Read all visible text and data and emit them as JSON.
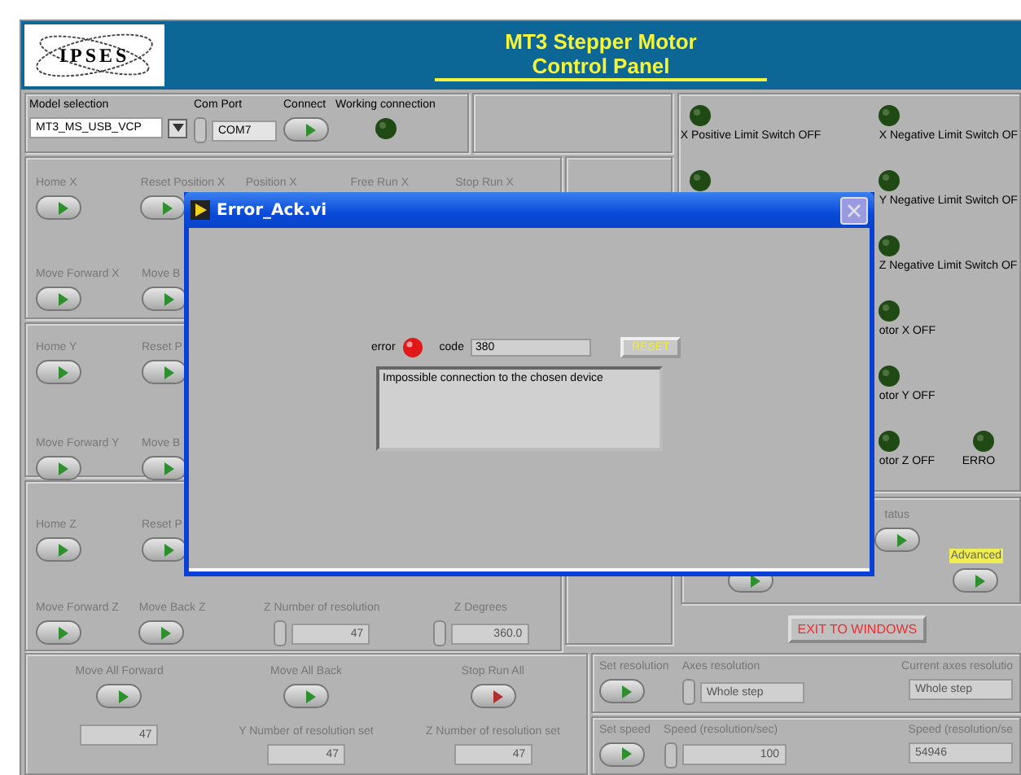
{
  "header": {
    "logo": "IPSES",
    "title": [
      "MT3 Stepper Motor",
      "Control Panel"
    ]
  },
  "connection": {
    "disabled": false,
    "controls": [
      {
        "kind": "ring",
        "label": "Model selection",
        "value": "MT3_MS_USB_VCP"
      },
      {
        "kind": "spin",
        "label": "Com Port",
        "value": "COM7"
      },
      {
        "kind": "switch",
        "label": "Connect",
        "color": "#2e8f2e"
      },
      {
        "kind": "led",
        "label": "Working connection",
        "on": false
      }
    ]
  },
  "axis_panels": [
    {
      "disabled": true,
      "rows": [
        [
          {
            "kind": "switch",
            "label": "Home X",
            "color": "#2e8f2e"
          },
          {
            "kind": "switch",
            "label": "Reset Position X",
            "color": "#2e8f2e"
          },
          {
            "kind": "label",
            "label": "Position X"
          },
          {
            "kind": "label",
            "label": "Free Run X"
          },
          {
            "kind": "label",
            "label": "Stop Run X"
          }
        ],
        [
          {
            "kind": "switch",
            "label": "Move Forward X",
            "color": "#2e8f2e"
          },
          {
            "kind": "switch",
            "label": "Move B",
            "color": "#2e8f2e"
          }
        ]
      ]
    },
    {
      "disabled": true,
      "rows": [
        [
          {
            "kind": "switch",
            "label": "Home Y",
            "color": "#2e8f2e"
          },
          {
            "kind": "switch",
            "label": "Reset P",
            "color": "#2e8f2e"
          }
        ],
        [
          {
            "kind": "switch",
            "label": "Move Forward Y",
            "color": "#2e8f2e"
          },
          {
            "kind": "switch",
            "label": "Move B",
            "color": "#2e8f2e"
          }
        ]
      ]
    },
    {
      "disabled": true,
      "rows": [
        [
          {
            "kind": "switch",
            "label": "Home Z",
            "color": "#2e8f2e"
          },
          {
            "kind": "switch",
            "label": "Reset P",
            "color": "#2e8f2e"
          }
        ],
        [
          {
            "kind": "switch",
            "label": "Move Forward Z",
            "color": "#2e8f2e"
          },
          {
            "kind": "switch",
            "label": "Move Back Z",
            "color": "#2e8f2e"
          },
          {
            "kind": "spin",
            "label": "Z Number of resolution",
            "value": "47"
          },
          {
            "kind": "spin",
            "label": "Z Degrees",
            "value": "360.0"
          }
        ]
      ]
    }
  ],
  "all_axes": {
    "disabled": true,
    "rows": [
      [
        {
          "kind": "switch",
          "label": "Move All Forward",
          "color": "#2e8f2e"
        },
        {
          "kind": "switch",
          "label": "Move All Back",
          "color": "#2e8f2e"
        },
        {
          "kind": "switch",
          "label": "Stop Run All",
          "color": "#b03030"
        }
      ],
      [
        {
          "kind": "display",
          "value": "47"
        },
        {
          "kind": "display",
          "label": "Y Number of resolution set",
          "value": "47"
        },
        {
          "kind": "display",
          "label": "Z Number of resolution set",
          "value": "47"
        }
      ]
    ]
  },
  "indicators": [
    [
      {
        "label": "X Positive Limit Switch OFF",
        "on": false
      },
      {
        "on": false
      }
    ],
    [
      {
        "label": "X Negative Limit Switch OF",
        "on": false
      },
      {
        "label": "Y Negative Limit Switch OF",
        "on": false
      },
      {
        "label": "Z Negative Limit Switch OF",
        "on": false
      },
      {
        "label": "otor X OFF",
        "on": false
      },
      {
        "label": "otor Y OFF",
        "on": false
      },
      {
        "label": "otor Z OFF",
        "on": false
      }
    ],
    [
      {
        "label": "ERRO",
        "on": false
      }
    ]
  ],
  "status": {
    "disabled": true,
    "controls": [
      {
        "kind": "switch",
        "color": "#2e8f2e"
      },
      {
        "kind": "switch",
        "label": "tatus",
        "color": "#2e8f2e",
        "highlighted": false
      },
      {
        "kind": "switch",
        "label": "Advanced",
        "color": "#2e8f2e",
        "highlighted": true
      }
    ]
  },
  "exit_button": "EXIT TO WINDOWS",
  "settings": [
    {
      "disabled": true,
      "controls": [
        {
          "kind": "switch",
          "label": "Set resolution",
          "color": "#2e8f2e"
        },
        {
          "kind": "ring",
          "label": "Axes resolution",
          "value": "Whole step"
        },
        {
          "kind": "display",
          "label": "Current axes resolutio",
          "value": "Whole step"
        }
      ]
    },
    {
      "disabled": true,
      "controls": [
        {
          "kind": "switch",
          "label": "Set speed",
          "color": "#2e8f2e"
        },
        {
          "kind": "spin",
          "label": "Speed (resolution/sec)",
          "value": "100"
        },
        {
          "kind": "display",
          "label": "Speed (resolution/se",
          "value": "54946"
        }
      ]
    }
  ],
  "dialog": {
    "title": "Error_Ack.vi",
    "error_label": "error",
    "error_on": true,
    "code_label": "code",
    "code": "380",
    "reset_button": "RESET",
    "message": "Impossible connection to the chosen device"
  }
}
